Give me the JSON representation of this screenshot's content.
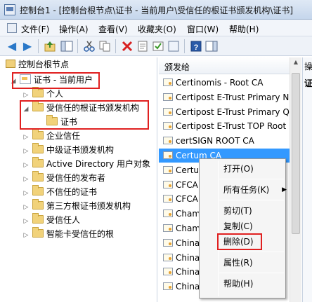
{
  "window": {
    "title": "控制台1 - [控制台根节点\\证书 - 当前用户\\受信任的根证书颁发机构\\证书]"
  },
  "menu": {
    "items": [
      "文件(F)",
      "操作(A)",
      "查看(V)",
      "收藏夹(O)",
      "窗口(W)",
      "帮助(H)"
    ]
  },
  "toolbar": {
    "buttons": [
      "back-arrow-icon",
      "forward-arrow-icon",
      "up-folder-icon",
      "show-hide-tree-icon",
      "cut-icon",
      "copy-icon",
      "delete-icon",
      "properties-icon",
      "refresh-icon",
      "export-list-icon",
      "help-icon",
      "show-hide-action-icon"
    ]
  },
  "tree": {
    "root": "控制台根节点",
    "cert_user": "证书 - 当前用户",
    "personal": "个人",
    "trusted_root": "受信任的根证书颁发机构",
    "certificates": "证书",
    "enterprise": "企业信任",
    "intermediate": "中级证书颁发机构",
    "ad_user": "Active Directory 用户对象",
    "trusted_publishers": "受信任的发布者",
    "untrusted": "不信任的证书",
    "third_party_root": "第三方根证书颁发机构",
    "trusted_people": "受信任人",
    "smartcard_root": "智能卡受信任的根"
  },
  "list": {
    "column_header": "颁发给",
    "rows": [
      "Certinomis - Root CA",
      "Certipost E-Trust Primary N",
      "Certipost E-Trust Primary Q",
      "Certipost E-Trust TOP Root",
      "certSIGN ROOT CA",
      "Certum CA",
      "Certum",
      "CFCA",
      "CFCA",
      "Cham",
      "Cham",
      "China",
      "China",
      "China",
      "China"
    ],
    "selected_index": 5
  },
  "action_pane": {
    "header": "操",
    "sub": "证"
  },
  "context_menu": {
    "open": "打开(O)",
    "all_tasks": "所有任务(K)",
    "cut": "剪切(T)",
    "copy": "复制(C)",
    "delete": "删除(D)",
    "properties": "属性(R)",
    "help": "帮助(H)"
  },
  "colors": {
    "highlight": "#3399ff",
    "annotation_red": "#e02020"
  }
}
